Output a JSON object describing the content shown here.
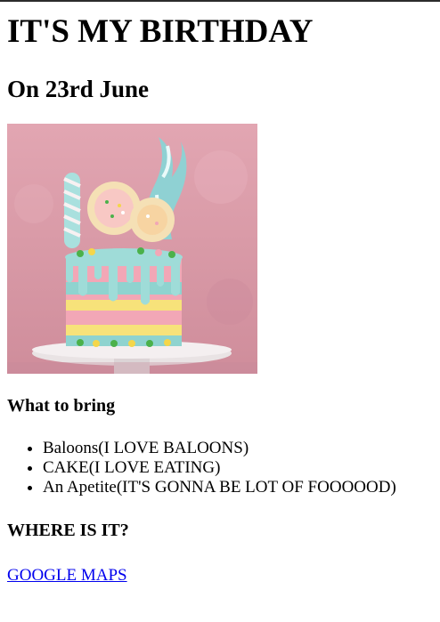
{
  "page": {
    "title": "IT'S MY BIRTHDAY",
    "date_line": "On 23rd June",
    "what_to_bring_heading": "What to bring",
    "bring_items": [
      "Baloons(I LOVE BALOONS)",
      "CAKE(I LOVE EATING)",
      "An Apetite(IT'S GONNA BE LOT OF FOOOOOD)"
    ],
    "where_heading": "WHERE IS IT?",
    "map_link_text": "GOOGLE MAPS"
  },
  "image": {
    "icon": "birthday-cake-photo",
    "background_color": "#d99aa6",
    "link_color": "#0000ee"
  }
}
